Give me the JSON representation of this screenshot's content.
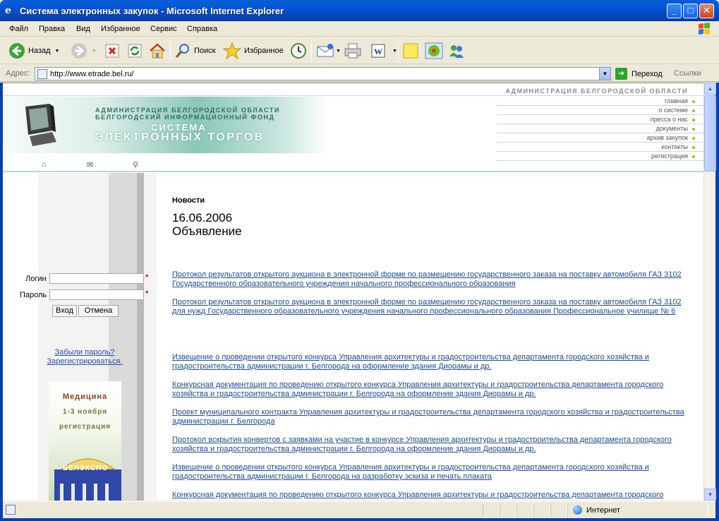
{
  "window": {
    "title": "Система электронных закупок - Microsoft Internet Explorer",
    "minimize": "_",
    "maximize": "□",
    "close": "✕"
  },
  "menu": [
    "Файл",
    "Правка",
    "Вид",
    "Избранное",
    "Сервис",
    "Справка"
  ],
  "toolbar": {
    "back": "Назад",
    "search": "Поиск",
    "favorites": "Избранное"
  },
  "address": {
    "label": "Адрес:",
    "url": "http://www.etrade.bel.ru/",
    "go": "Переход",
    "links": "Ссылки"
  },
  "page": {
    "admin_top": "АДМИНИСТРАЦИЯ БЕЛГОРОДСКОЙ ОБЛАСТИ",
    "banner": {
      "line1": "АДМИНИСТРАЦИЯ БЕЛГОРОДСКОЙ ОБЛАСТИ",
      "line2": "БЕЛГОРОДСКИЙ ИНФОРМАЦИОННЫЙ ФОНД",
      "line3": "СИСТЕМА",
      "line4": "ЭЛЕКТРОННЫХ ТОРГОВ"
    },
    "nav": [
      "главная",
      "о системе",
      "пресса о нас",
      "документы",
      "архив закупок",
      "контакты",
      "регистрация"
    ],
    "login": {
      "login_label": "Логин",
      "password_label": "Пароль",
      "login_value": "",
      "password_value": "",
      "required_mark": "*",
      "enter": "Вход",
      "cancel": "Отмена",
      "forgot": "Забыли пароль?",
      "register": "Зарегистрироваться."
    },
    "ad": {
      "title": "Медицина",
      "dates": "1-3 ноября",
      "reg": "регистрация",
      "brand": "БЕЛЭКСПО"
    },
    "news": {
      "heading": "Новости",
      "date": "16.06.2006",
      "type": "Объявление",
      "links": [
        "Протокол результатов открытого аукциона в электронной форме по размещению государственного заказа на поставку автомобиля ГАЗ 3102 Государственного образовательного учреждения начального профессионального образования",
        "Протокол результатов открытого аукциона в электронной форме по размещению государственного заказа на поставку автомобиля ГАЗ 3102 для нужд Государственного образовательного учреждения начального профессионального образования Профессиональное училище № 6",
        "Извещение о проведении открытого конкурса Управления архитектуры и градостроительства департамента городского хозяйства и градостроительства администрации г. Белгорода на оформление здания Диорамы и др.",
        "Конкурсная документация по проведению открытого конкурса Управления архитектуры и градостроительства департамента городского хозяйства и градостроительства администрации г. Белгорода на оформление здания Диорамы и др.",
        "Проект муниципального контракта Управления архитектуры и градостроительства департамента городского хозяйства и градостроительства администрации г. Белгорода",
        "Протокол вскрытия конвертов с заявками на участие в конкурсе Управления архитектуры и градостроительства департамента городского хозяйства и градостроительства администрации г. Белгорода на оформление здания Диорамы и др.",
        "Извещение о проведении открытого конкурса Управления архитектуры и градостроительства департамента городского хозяйства и градостроительства администрации г. Белгорода на разработку эскиза и печать плаката",
        "Конкурсная документация по проведению открытого конкурса Управления архитектуры и градостроительства департамента городского"
      ]
    }
  },
  "status": {
    "zone": "Интернет"
  },
  "colors": {
    "link": "#1d4cab",
    "titlebar": "#0a5fd8",
    "accent_teal": "#8ac7b6"
  },
  "icons": [
    "ie-icon",
    "back-icon",
    "forward-icon",
    "stop-icon",
    "refresh-icon",
    "home-icon",
    "search-icon",
    "favorites-icon",
    "history-icon",
    "mail-icon",
    "print-icon",
    "edit-icon",
    "notes-icon",
    "icq-icon",
    "messenger-icon",
    "go-icon",
    "globe-icon",
    "windows-logo-icon"
  ]
}
